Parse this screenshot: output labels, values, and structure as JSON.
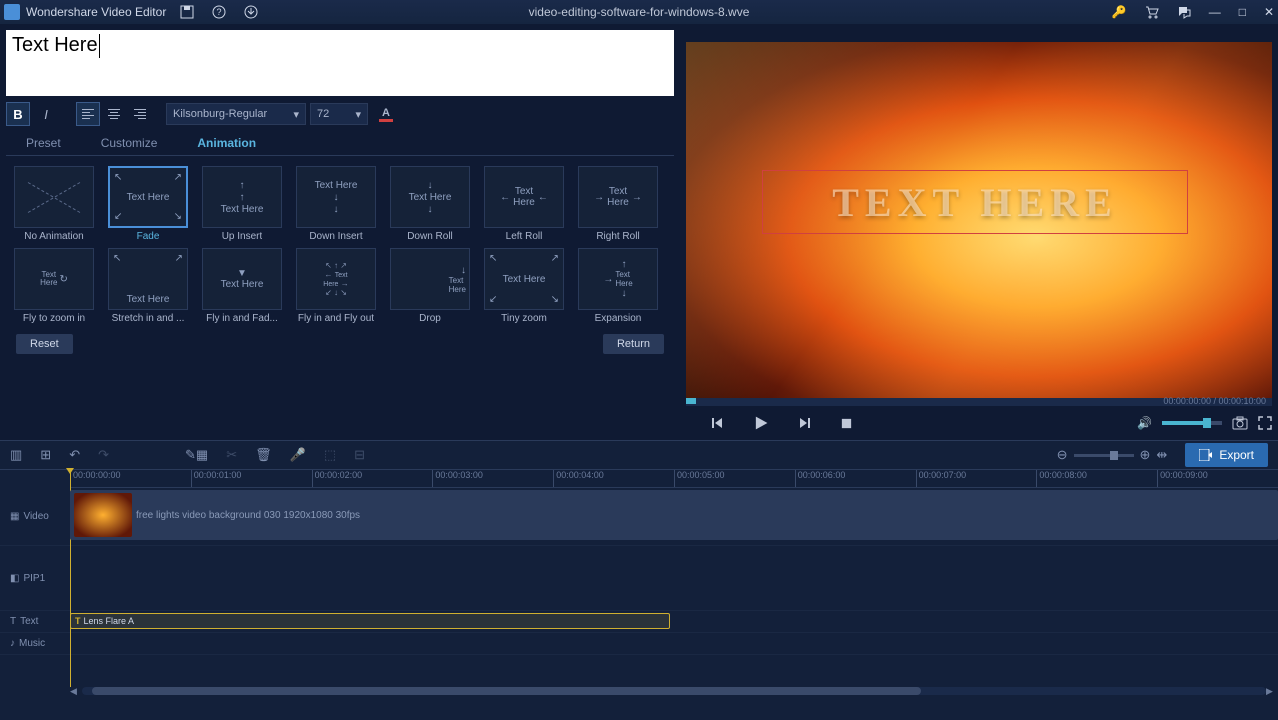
{
  "app": {
    "name": "Wondershare Video Editor",
    "filename": "video-editing-software-for-windows-8.wve"
  },
  "editor": {
    "text_value": "Text Here",
    "font": "Kilsonburg-Regular",
    "size": "72",
    "tabs": {
      "preset": "Preset",
      "customize": "Customize",
      "animation": "Animation"
    },
    "reset": "Reset",
    "return": "Return"
  },
  "animations": [
    {
      "label": "No Animation",
      "key": "none"
    },
    {
      "label": "Fade",
      "key": "fade",
      "selected": true
    },
    {
      "label": "Up Insert",
      "key": "up-insert"
    },
    {
      "label": "Down Insert",
      "key": "down-insert"
    },
    {
      "label": "Down Roll",
      "key": "down-roll"
    },
    {
      "label": "Left Roll",
      "key": "left-roll"
    },
    {
      "label": "Right Roll",
      "key": "right-roll"
    },
    {
      "label": "Fly to zoom in",
      "key": "fly-zoom"
    },
    {
      "label": "Stretch in and ...",
      "key": "stretch"
    },
    {
      "label": "Fly in and Fad...",
      "key": "flyin-fade"
    },
    {
      "label": "Fly in and Fly out",
      "key": "flyin-flyout"
    },
    {
      "label": "Drop",
      "key": "drop"
    },
    {
      "label": "Tiny zoom",
      "key": "tiny-zoom"
    },
    {
      "label": "Expansion",
      "key": "expansion"
    }
  ],
  "preview": {
    "overlay_text": "TEXT HERE"
  },
  "player": {
    "time": "00:00:00:00 / 00:00:10:00"
  },
  "timeline": {
    "export": "Export",
    "ruler": [
      "00:00:00:00",
      "00:00:01:00",
      "00:00:02:00",
      "00:00:03:00",
      "00:00:04:00",
      "00:00:05:00",
      "00:00:06:00",
      "00:00:07:00",
      "00:00:08:00",
      "00:00:09:00"
    ],
    "tracks": {
      "video": {
        "label": "Video",
        "clip": "free lights video background 030 1920x1080 30fps"
      },
      "pip": {
        "label": "PIP1"
      },
      "text": {
        "label": "Text",
        "clip": "Lens Flare A"
      },
      "music": {
        "label": "Music"
      }
    }
  },
  "thumb_text": "Text Here"
}
